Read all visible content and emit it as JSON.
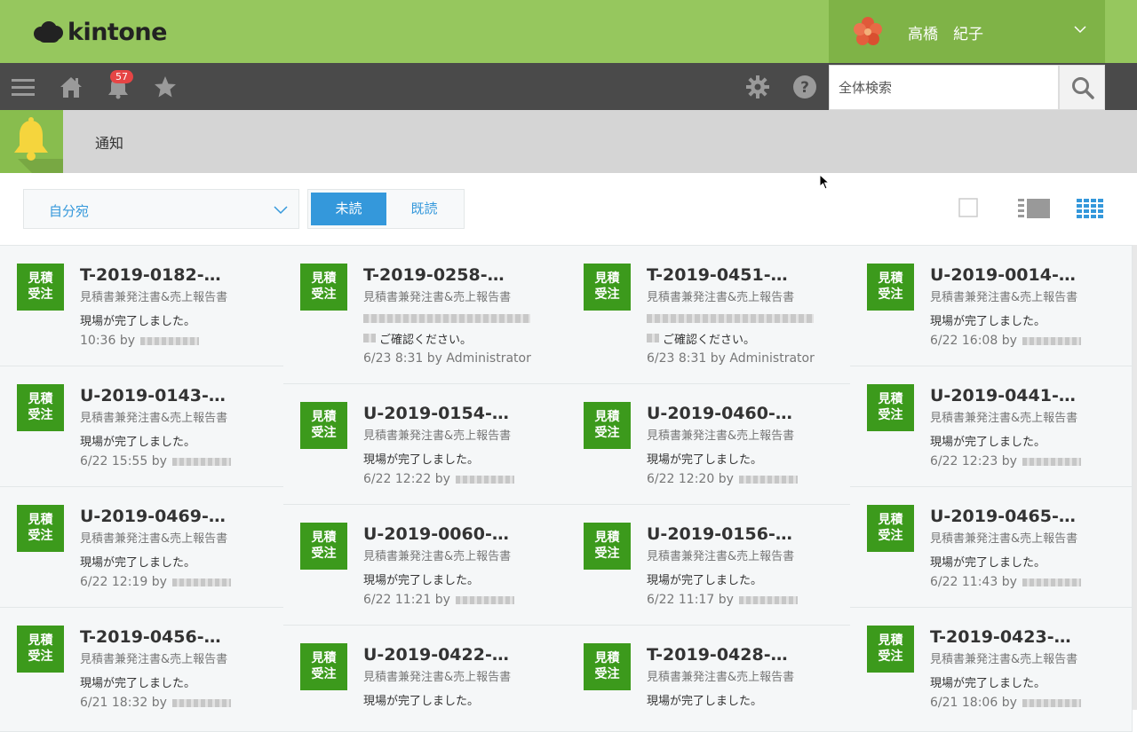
{
  "header": {
    "logo_text": "kintone",
    "user_name": "高橋　紀子"
  },
  "nav": {
    "notification_count": "57",
    "search_placeholder": "全体検索"
  },
  "page": {
    "title": "通知"
  },
  "filter": {
    "dropdown_label": "自分宛",
    "unread_label": "未読",
    "read_label": "既読"
  },
  "colors": {
    "header_green": "#96c75e",
    "user_green": "#7fb347",
    "nav_dark": "#4a4a4a",
    "accent_blue": "#3498db",
    "app_icon_green": "#3c9a1c",
    "badge_red": "#e64545"
  },
  "app_icon_label": [
    "見積",
    "受注"
  ],
  "columns": [
    [
      {
        "title": "T-2019-0182-…",
        "app": "見積書兼発注書&売上報告書",
        "message": "現場が完了しました。",
        "time": "10:36",
        "by": "by"
      },
      {
        "title": "U-2019-0143-…",
        "app": "見積書兼発注書&売上報告書",
        "message": "現場が完了しました。",
        "time": "6/22 15:55",
        "by": "by"
      },
      {
        "title": "U-2019-0469-…",
        "app": "見積書兼発注書&売上報告書",
        "message": "現場が完了しました。",
        "time": "6/22 12:19",
        "by": "by"
      },
      {
        "title": "T-2019-0456-…",
        "app": "見積書兼発注書&売上報告書",
        "message": "現場が完了しました。",
        "time": "6/21 18:32",
        "by": "by"
      }
    ],
    [
      {
        "title": "T-2019-0258-…",
        "app": "見積書兼発注書&売上報告書",
        "message": "ご確認ください。",
        "time": "6/23 8:31",
        "by": "by Administrator",
        "redacted_lines": true
      },
      {
        "title": "U-2019-0154-…",
        "app": "見積書兼発注書&売上報告書",
        "message": "現場が完了しました。",
        "time": "6/22 12:22",
        "by": "by"
      },
      {
        "title": "U-2019-0060-…",
        "app": "見積書兼発注書&売上報告書",
        "message": "現場が完了しました。",
        "time": "6/22 11:21",
        "by": "by"
      },
      {
        "title": "U-2019-0422-…",
        "app": "見積書兼発注書&売上報告書",
        "message": "現場が完了しました。",
        "time": "",
        "by": ""
      }
    ],
    [
      {
        "title": "T-2019-0451-…",
        "app": "見積書兼発注書&売上報告書",
        "message": "ご確認ください。",
        "time": "6/23 8:31",
        "by": "by Administrator",
        "redacted_lines": true
      },
      {
        "title": "U-2019-0460-…",
        "app": "見積書兼発注書&売上報告書",
        "message": "現場が完了しました。",
        "time": "6/22 12:20",
        "by": "by"
      },
      {
        "title": "U-2019-0156-…",
        "app": "見積書兼発注書&売上報告書",
        "message": "現場が完了しました。",
        "time": "6/22 11:17",
        "by": "by"
      },
      {
        "title": "T-2019-0428-…",
        "app": "見積書兼発注書&売上報告書",
        "message": "現場が完了しました。",
        "time": "",
        "by": ""
      }
    ],
    [
      {
        "title": "U-2019-0014-…",
        "app": "見積書兼発注書&売上報告書",
        "message": "現場が完了しました。",
        "time": "6/22 16:08",
        "by": "by"
      },
      {
        "title": "U-2019-0441-…",
        "app": "見積書兼発注書&売上報告書",
        "message": "現場が完了しました。",
        "time": "6/22 12:23",
        "by": "by"
      },
      {
        "title": "U-2019-0465-…",
        "app": "見積書兼発注書&売上報告書",
        "message": "現場が完了しました。",
        "time": "6/22 11:43",
        "by": "by"
      },
      {
        "title": "T-2019-0423-…",
        "app": "見積書兼発注書&売上報告書",
        "message": "現場が完了しました。",
        "time": "6/21 18:06",
        "by": "by"
      }
    ]
  ]
}
